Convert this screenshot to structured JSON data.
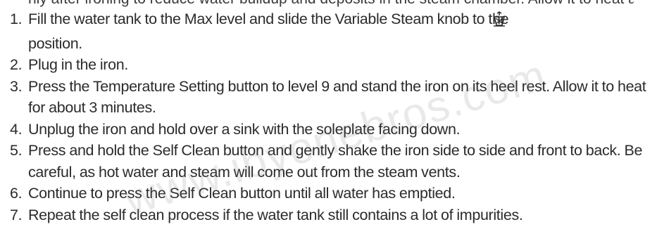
{
  "partial_top_line": "nly after ironing to reduce water buildup and deposits in the steam chamber. Allow it to heat and stop ironing, p",
  "watermark": "www.ibyonebros.com",
  "steps": [
    {
      "num": "1.",
      "text": "Fill the water tank to the Max level and slide the Variable Steam knob to the",
      "icon": "self-clean-steam-icon",
      "text_after": "position."
    },
    {
      "num": "2.",
      "text": "Plug in the iron."
    },
    {
      "num": "3.",
      "text": "Press the Temperature Setting button to level 9 and stand the iron on its heel rest. Allow it to heat for about 3 minutes."
    },
    {
      "num": "4.",
      "text": "Unplug the iron and hold over a sink with the soleplate facing down."
    },
    {
      "num": "5.",
      "text": "Press and hold the Self Clean button and gently shake the iron side to side and front to back. Be careful, as hot water and steam will come out from the steam vents."
    },
    {
      "num": "6.",
      "text": "Continue to press the Self Clean button until all water has emptied."
    },
    {
      "num": "7.",
      "text": "Repeat the self clean process if the water tank still contains a lot of impurities."
    }
  ]
}
